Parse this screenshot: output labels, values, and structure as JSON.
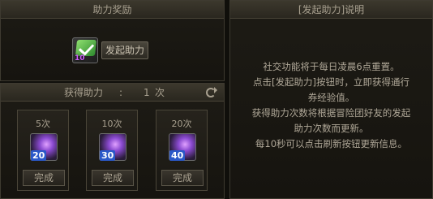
{
  "left_top": {
    "title": "助力奖励",
    "gift_count": "10",
    "initiate_button": "发起助力"
  },
  "left_bottom": {
    "gain_label": "获得助力",
    "gain_separator": ":",
    "gain_value": "1",
    "gain_unit": "次",
    "rewards": [
      {
        "times": "5次",
        "item_count": "20",
        "button": "完成"
      },
      {
        "times": "10次",
        "item_count": "30",
        "button": "完成"
      },
      {
        "times": "20次",
        "item_count": "40",
        "button": "完成"
      }
    ]
  },
  "right_panel": {
    "title": "[发起助力]说明",
    "lines": [
      "社交功能将于每日凌晨6点重置。",
      "点击[发起助力]按钮时，立即获得通行",
      "券经验值。",
      "获得助力次数将根据冒险团好友的发起",
      "助力次数而更新。",
      "每10秒可以点击刷新按钮更新信息。"
    ]
  }
}
